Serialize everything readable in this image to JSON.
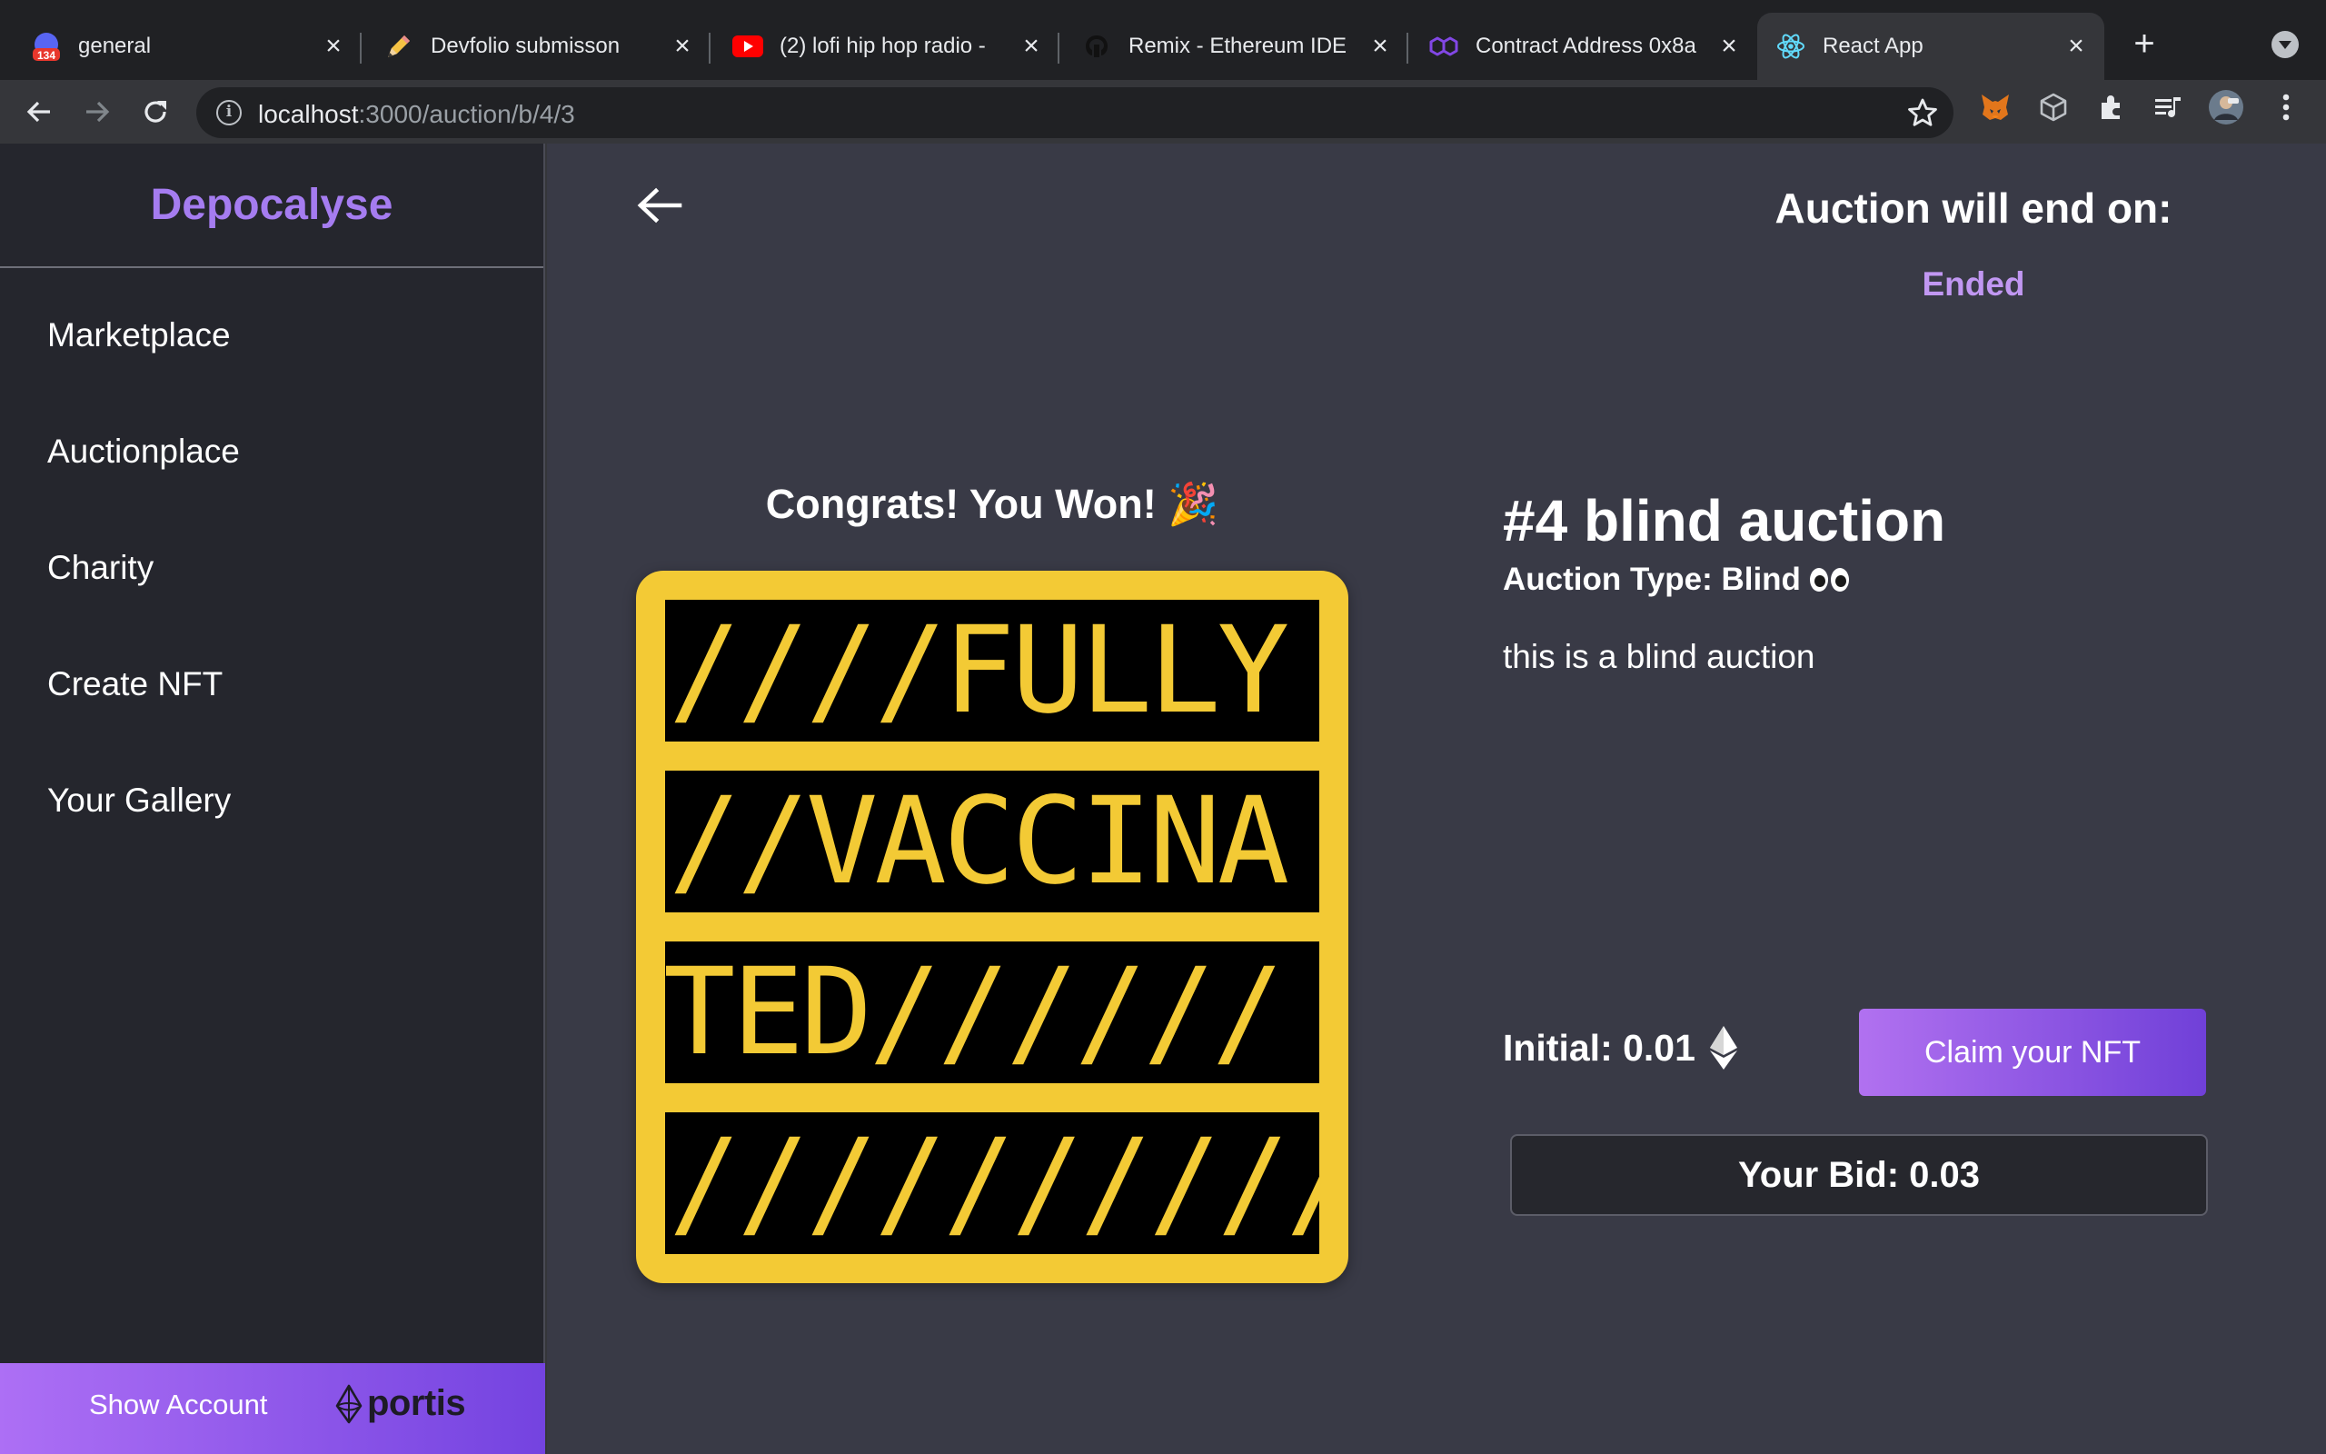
{
  "browser": {
    "tabs": [
      {
        "title": "general",
        "badge": "134",
        "icon": "discord-icon",
        "active": false
      },
      {
        "title": "Devfolio submisson",
        "icon": "pencil-icon",
        "active": false
      },
      {
        "title": "(2) lofi hip hop radio - ",
        "icon": "youtube-icon",
        "active": false
      },
      {
        "title": "Remix - Ethereum IDE",
        "icon": "remix-icon",
        "active": false
      },
      {
        "title": "Contract Address 0x8a",
        "icon": "polygon-icon",
        "active": false
      },
      {
        "title": "React App",
        "icon": "react-icon",
        "active": true
      }
    ],
    "url_host": "localhost",
    "url_path": ":3000/auction/b/4/3",
    "colors": {
      "tabstrip": "#202124",
      "toolbar": "#35363a"
    }
  },
  "sidebar": {
    "brand": "Depocalyse",
    "items": [
      {
        "label": "Marketplace"
      },
      {
        "label": "Auctionplace"
      },
      {
        "label": "Charity"
      },
      {
        "label": "Create NFT"
      },
      {
        "label": "Your Gallery"
      }
    ],
    "show_account": "Show Account",
    "wallet_logo": "portis"
  },
  "main": {
    "end_label": "Auction will end on:",
    "end_value": "Ended",
    "congrats": "Congrats! You Won! 🎉",
    "nft_text_rows": [
      "////FULLY",
      "//VACCINA",
      "TED//////",
      "//////////"
    ],
    "title": "#4 blind auction",
    "auction_type": "Auction Type: Blind",
    "description": "this is a blind auction",
    "initial": "Initial: 0.01",
    "claim_button": "Claim your NFT",
    "your_bid": "Your Bid: 0.03"
  },
  "colors": {
    "accent": "#a57cf0",
    "ended": "#c197f2",
    "nft_yellow": "#f3ca35",
    "main_bg": "#393a46",
    "sidebar_bg": "#25262d"
  }
}
